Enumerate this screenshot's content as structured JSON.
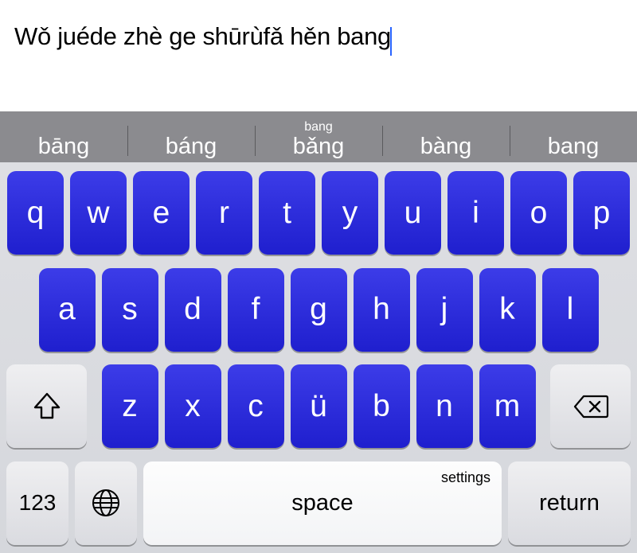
{
  "input": {
    "text": "Wǒ juéde zhè ge shūrùfǎ hěn bang"
  },
  "suggestions": [
    {
      "small": "",
      "main": "bāng"
    },
    {
      "small": "",
      "main": "báng"
    },
    {
      "small": "bang",
      "main": "bǎng"
    },
    {
      "small": "",
      "main": "bàng"
    },
    {
      "small": "",
      "main": "bang"
    }
  ],
  "keys": {
    "row1": [
      "q",
      "w",
      "e",
      "r",
      "t",
      "y",
      "u",
      "i",
      "o",
      "p"
    ],
    "row2": [
      "a",
      "s",
      "d",
      "f",
      "g",
      "h",
      "j",
      "k",
      "l"
    ],
    "row3": [
      "z",
      "x",
      "c",
      "ü",
      "b",
      "n",
      "m"
    ]
  },
  "func": {
    "num": "123",
    "space": "space",
    "settings": "settings",
    "ret": "return"
  }
}
